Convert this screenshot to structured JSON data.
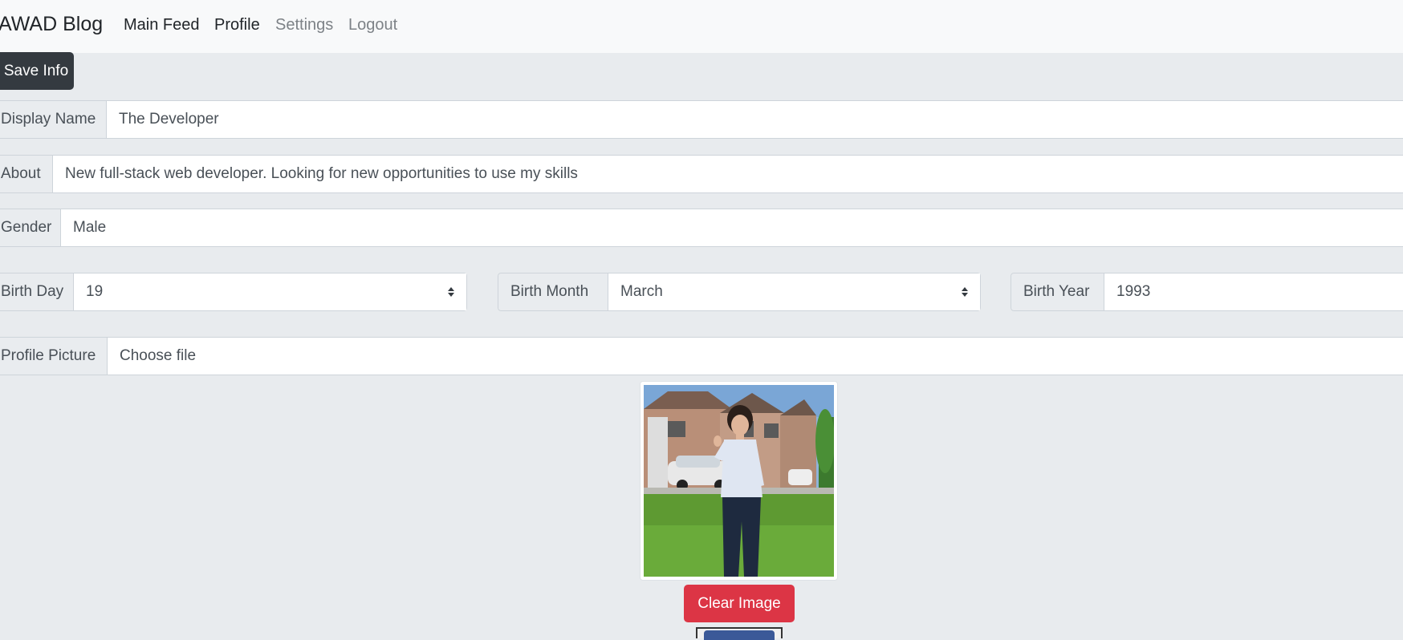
{
  "nav": {
    "brand": "AWAD Blog",
    "links": [
      "Main Feed",
      "Profile",
      "Settings",
      "Logout"
    ]
  },
  "form": {
    "save_label": "Save Info",
    "display_name": {
      "label": "Display Name",
      "value": "The Developer"
    },
    "about": {
      "label": "About",
      "value": "New full-stack web developer. Looking for new opportunities to use my skills"
    },
    "gender": {
      "label": "Gender",
      "value": "Male"
    },
    "birth_day": {
      "label": "Birth Day",
      "value": "19"
    },
    "birth_month": {
      "label": "Birth Month",
      "value": "March"
    },
    "birth_year": {
      "label": "Birth Year",
      "value": "1993"
    },
    "profile_picture": {
      "label": "Profile Picture",
      "value": "Choose file"
    },
    "clear_image_label": "Clear Image"
  },
  "colors": {
    "navbar_bg": "#f8f9fa",
    "page_bg": "#e8ebee",
    "dark_button": "#343a40",
    "danger_button": "#dc3545"
  }
}
